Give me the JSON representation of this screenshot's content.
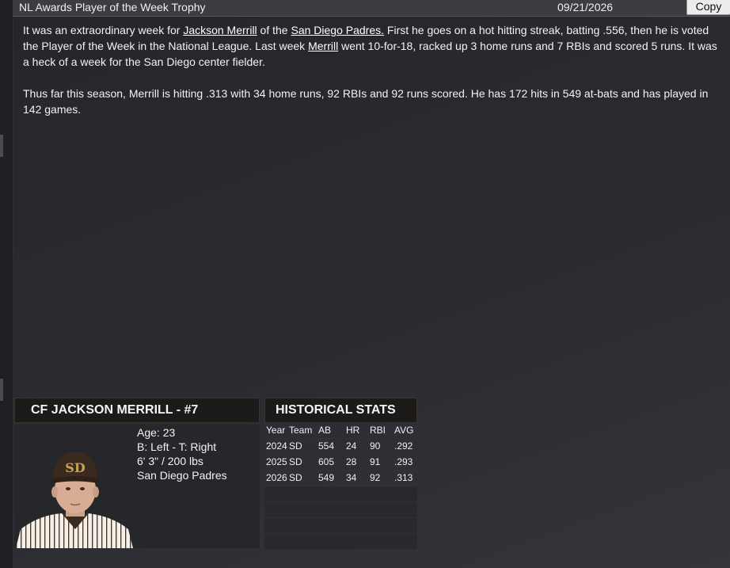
{
  "header": {
    "title": "NL Awards Player of the Week Trophy",
    "date": "09/21/2026",
    "copy_label": "Copy"
  },
  "article": {
    "p1": {
      "t1": "It was an extraordinary week for ",
      "player_link": "Jackson Merrill",
      "t2": " of the ",
      "team_link": "San Diego Padres.",
      "t3": " First he goes on a hot hitting streak, batting .556, then he is voted the Player of the Week in the National League. Last week ",
      "player_link2": "Merrill",
      "t4": " went 10-for-18, racked up 3 home runs and 7 RBIs and scored 5 runs. It was a heck of a week for the San Diego center fielder."
    },
    "p2": "Thus far this season, Merrill is hitting .313 with 34 home runs, 92 RBIs and 92 runs scored. He has 172 hits in 549 at-bats and has played in 142 games."
  },
  "player": {
    "heading": "CF JACKSON MERRILL - #7",
    "age": "Age: 23",
    "bats_throws": "B: Left - T: Right",
    "height_weight": "6' 3\"  / 200 lbs",
    "team": "San Diego Padres",
    "cap_logo": "SD"
  },
  "stats": {
    "heading": "HISTORICAL STATS",
    "columns": [
      "Year",
      "Team",
      "AB",
      "HR",
      "RBI",
      "AVG"
    ],
    "rows": [
      [
        "2024",
        "SD",
        "554",
        "24",
        "90",
        ".292"
      ],
      [
        "2025",
        "SD",
        "605",
        "28",
        "91",
        ".293"
      ],
      [
        "2026",
        "SD",
        "549",
        "34",
        "92",
        ".313"
      ]
    ]
  },
  "colors": {
    "background": "#2a2c31",
    "header_bar": "#3b3d42",
    "panel_header": "#1d1b1a",
    "padres_brown": "#3b2a1e",
    "padres_gold": "#c9a25a"
  }
}
